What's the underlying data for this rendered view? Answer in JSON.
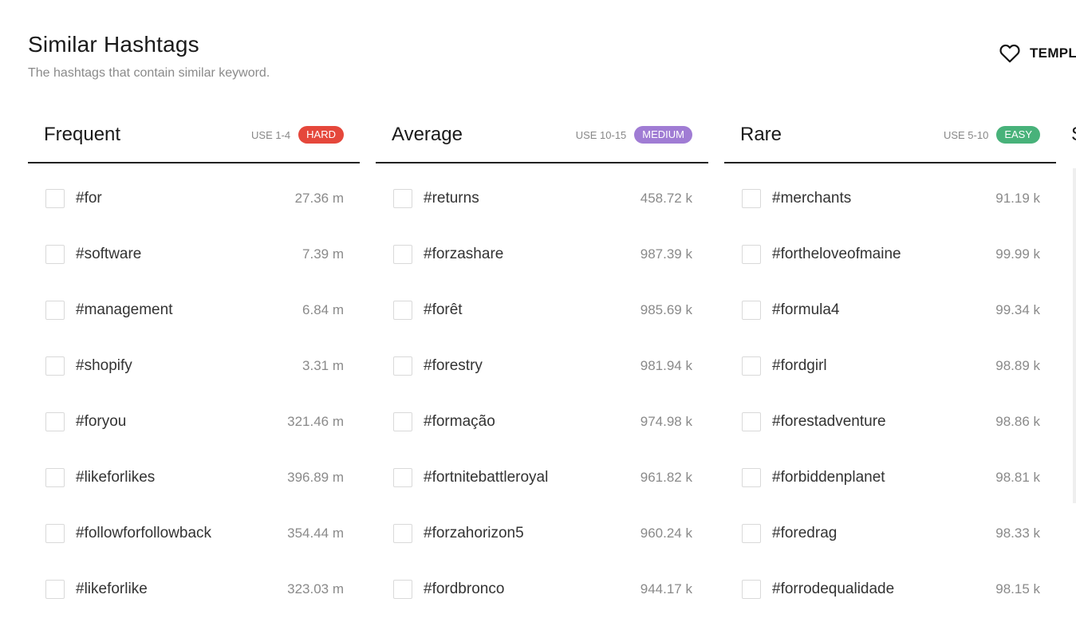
{
  "header": {
    "title": "Similar Hashtags",
    "subtitle": "The hashtags that contain similar keyword.",
    "templates_label": "TEMPL"
  },
  "fourth_column_partial": "S",
  "columns": [
    {
      "name": "Frequent",
      "use": "USE 1-4",
      "badge": "HARD",
      "badge_color": "#e5473b",
      "rows": [
        {
          "tag": "#for",
          "count": "27.36 m"
        },
        {
          "tag": "#software",
          "count": "7.39 m"
        },
        {
          "tag": "#management",
          "count": "6.84 m"
        },
        {
          "tag": "#shopify",
          "count": "3.31 m"
        },
        {
          "tag": "#foryou",
          "count": "321.46 m"
        },
        {
          "tag": "#likeforlikes",
          "count": "396.89 m"
        },
        {
          "tag": "#followforfollowback",
          "count": "354.44 m"
        },
        {
          "tag": "#likeforlike",
          "count": "323.03 m"
        }
      ]
    },
    {
      "name": "Average",
      "use": "USE 10-15",
      "badge": "MEDIUM",
      "badge_color": "#a07cd4",
      "rows": [
        {
          "tag": "#returns",
          "count": "458.72 k"
        },
        {
          "tag": "#forzashare",
          "count": "987.39 k"
        },
        {
          "tag": "#forêt",
          "count": "985.69 k"
        },
        {
          "tag": "#forestry",
          "count": "981.94 k"
        },
        {
          "tag": "#formação",
          "count": "974.98 k"
        },
        {
          "tag": "#fortnitebattleroyal",
          "count": "961.82 k"
        },
        {
          "tag": "#forzahorizon5",
          "count": "960.24 k"
        },
        {
          "tag": "#fordbronco",
          "count": "944.17 k"
        }
      ]
    },
    {
      "name": "Rare",
      "use": "USE 5-10",
      "badge": "EASY",
      "badge_color": "#48b27a",
      "rows": [
        {
          "tag": "#merchants",
          "count": "91.19 k"
        },
        {
          "tag": "#fortheloveofmaine",
          "count": "99.99 k"
        },
        {
          "tag": "#formula4",
          "count": "99.34 k"
        },
        {
          "tag": "#fordgirl",
          "count": "98.89 k"
        },
        {
          "tag": "#forestadventure",
          "count": "98.86 k"
        },
        {
          "tag": "#forbiddenplanet",
          "count": "98.81 k"
        },
        {
          "tag": "#foredrag",
          "count": "98.33 k"
        },
        {
          "tag": "#forrodequalidade",
          "count": "98.15 k"
        }
      ]
    }
  ]
}
